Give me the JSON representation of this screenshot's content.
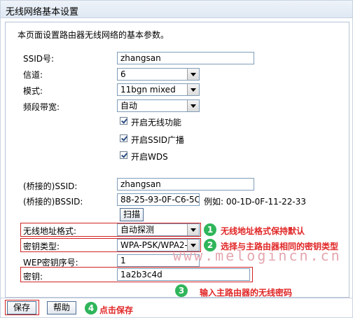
{
  "page_title": "无线网络基本设置",
  "description": "本页面设置路由器无线网络的基本参数。",
  "fields": {
    "ssid": {
      "label": "SSID号:",
      "value": "zhangsan"
    },
    "channel": {
      "label": "信道:",
      "value": "6"
    },
    "mode": {
      "label": "模式:",
      "value": "11bgn mixed"
    },
    "bandwidth": {
      "label": "频段带宽:",
      "value": "自动"
    }
  },
  "checkboxes": {
    "wireless": {
      "label": "开启无线功能",
      "checked": true
    },
    "ssid_broadcast": {
      "label": "开启SSID广播",
      "checked": true
    },
    "wds": {
      "label": "开启WDS",
      "checked": true
    }
  },
  "bridge": {
    "ssid_label": "(桥接的)SSID:",
    "ssid_value": "zhangsan",
    "bssid_label": "(桥接的)BSSID:",
    "bssid_value": "88-25-93-0F-C6-5C",
    "bssid_example": "例如: 00-1D-0F-11-22-33",
    "scan_button": "扫描"
  },
  "security": {
    "addr_format_label": "无线地址格式:",
    "addr_format_value": "自动探测",
    "key_type_label": "密钥类型:",
    "key_type_value": "WPA-PSK/WPA2-",
    "wep_index_label": "WEP密钥序号:",
    "wep_index_value": "1",
    "key_label": "密钥:",
    "key_value": "1a2b3c4d"
  },
  "buttons": {
    "save": "保存",
    "help": "帮助"
  },
  "annotations": {
    "n1": "1",
    "t1": "无线地址格式保持默认",
    "n2": "2",
    "t2": "选择与主路由器相同的密钥类型",
    "n3": "3",
    "t3": "输入主路由器的无线密码",
    "n4": "4",
    "t4": "点击保存"
  },
  "watermark": "www.melogincn.cn",
  "colors": {
    "annotation_red": "#e12626",
    "step_green": "#2fb55a"
  }
}
